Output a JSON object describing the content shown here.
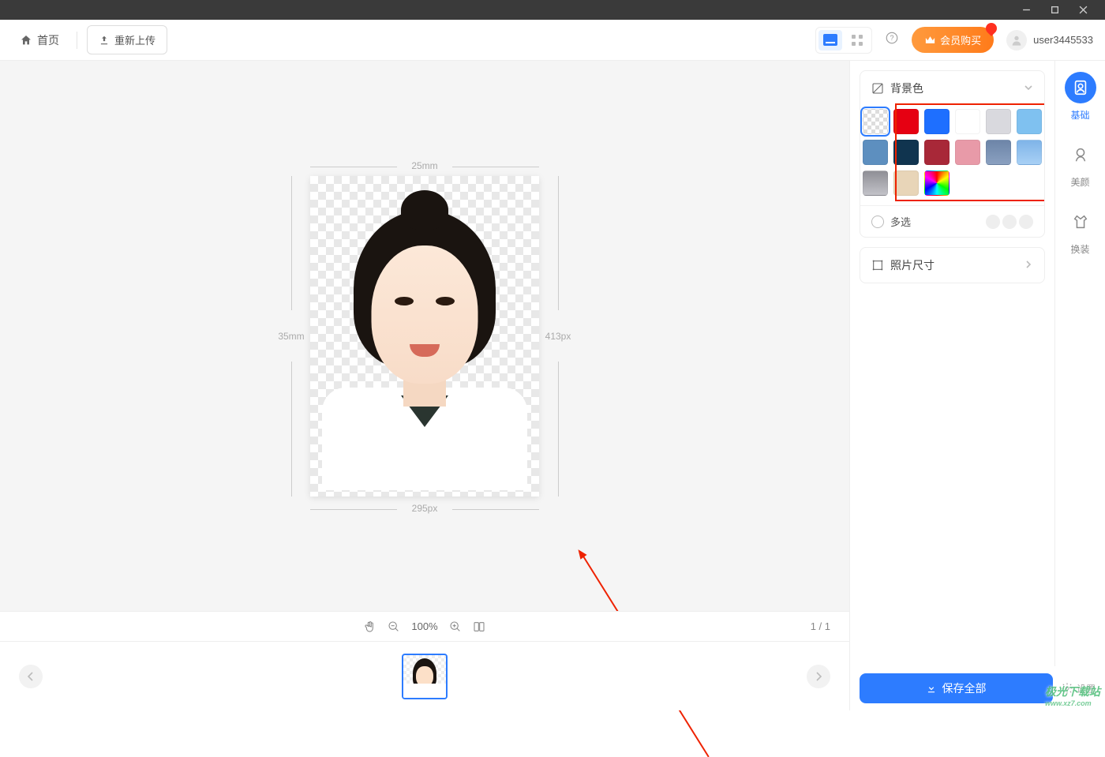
{
  "header": {
    "home": "首页",
    "reupload": "重新上传",
    "vip": "会员购买",
    "username": "user3445533"
  },
  "canvas": {
    "dim_top": "25mm",
    "dim_left": "35mm",
    "dim_right": "413px",
    "dim_bottom": "295px",
    "zoom": "100%",
    "page": "1 / 1"
  },
  "panel": {
    "bg_label": "背景色",
    "multi": "多选",
    "size_label": "照片尺寸",
    "colors": [
      {
        "id": "transparent",
        "css": "",
        "cls": "transparent selected"
      },
      {
        "id": "red",
        "css": "#e60012"
      },
      {
        "id": "blue",
        "css": "#1e6fff"
      },
      {
        "id": "white",
        "css": "#ffffff"
      },
      {
        "id": "lgray",
        "css": "#d9d9de"
      },
      {
        "id": "sky",
        "css": "#7fc1f0"
      },
      {
        "id": "steel",
        "css": "#5d8fbf"
      },
      {
        "id": "navy",
        "css": "#10344f"
      },
      {
        "id": "crimson",
        "css": "#a82838"
      },
      {
        "id": "pink",
        "css": "#e89aa8"
      },
      {
        "id": "slate",
        "css": "linear-gradient(180deg,#6d85a8,#8aa0c0)"
      },
      {
        "id": "lblue",
        "css": "linear-gradient(180deg,#7fb4e8,#a8d0f5)"
      },
      {
        "id": "graygrad",
        "css": "linear-gradient(180deg,#8f8f96,#c2c2c8)"
      },
      {
        "id": "beige",
        "css": "#e8d5b8"
      },
      {
        "id": "rainbow",
        "css": "",
        "cls": "rainbow"
      }
    ]
  },
  "sidebar": {
    "items": [
      {
        "id": "basic",
        "label": "基础"
      },
      {
        "id": "beauty",
        "label": "美颜"
      },
      {
        "id": "dress",
        "label": "换装"
      }
    ]
  },
  "footer": {
    "save": "保存全部",
    "settings": "设置"
  },
  "watermark": {
    "line1": "极光下载站",
    "line2": "www.xz7.com"
  }
}
